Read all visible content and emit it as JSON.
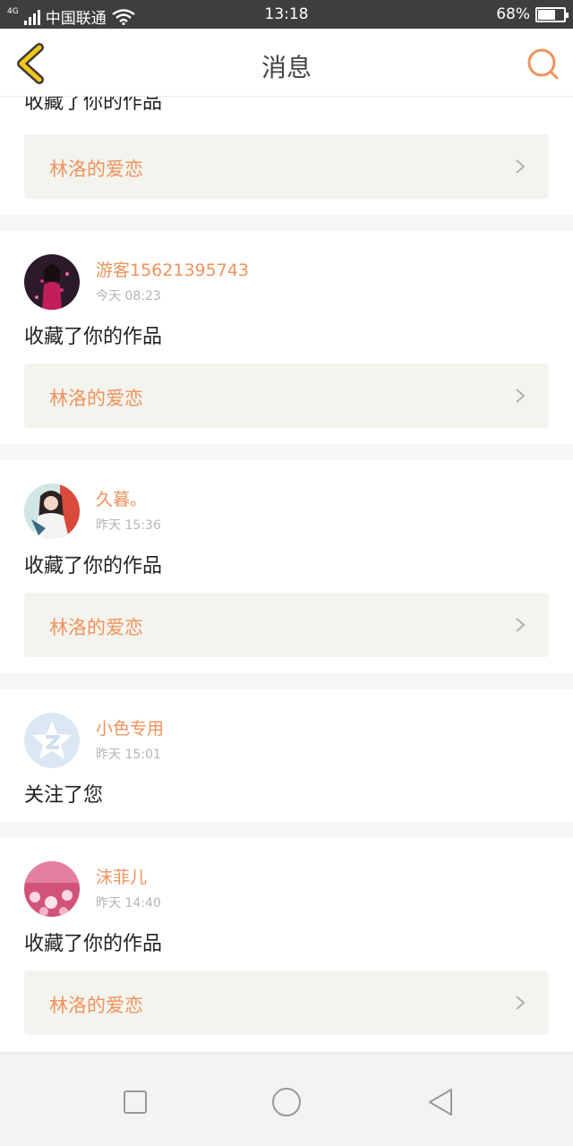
{
  "status_bar": {
    "network": "4G",
    "carrier": "中国联通",
    "time": "13:18",
    "battery": "68%",
    "battery_level": 0.68
  },
  "header": {
    "title": "消息",
    "back_icon": "chevron-left-icon",
    "search_icon": "search-icon"
  },
  "colors": {
    "accent": "#f0925a",
    "back_icon_fill": "#f5c518",
    "background": "#f6f6f6"
  },
  "messages": [
    {
      "action": "收藏了你的作品",
      "work_title": "林洛的爱恋"
    },
    {
      "user_name": "游客15621395743",
      "time": "今天 08:23",
      "action": "收藏了你的作品",
      "work_title": "林洛的爱恋"
    },
    {
      "user_name": "久暮。",
      "time": "昨天 15:36",
      "action": "收藏了你的作品",
      "work_title": "林洛的爱恋"
    },
    {
      "user_name": "小色专用",
      "time": "昨天 15:01",
      "action": "关注了您"
    },
    {
      "user_name": "沫菲儿",
      "time": "昨天 14:40",
      "action": "收藏了你的作品",
      "work_title": "林洛的爱恋"
    }
  ],
  "nav": {
    "recent_icon": "square-icon",
    "home_icon": "circle-icon",
    "back_icon": "triangle-back-icon"
  }
}
